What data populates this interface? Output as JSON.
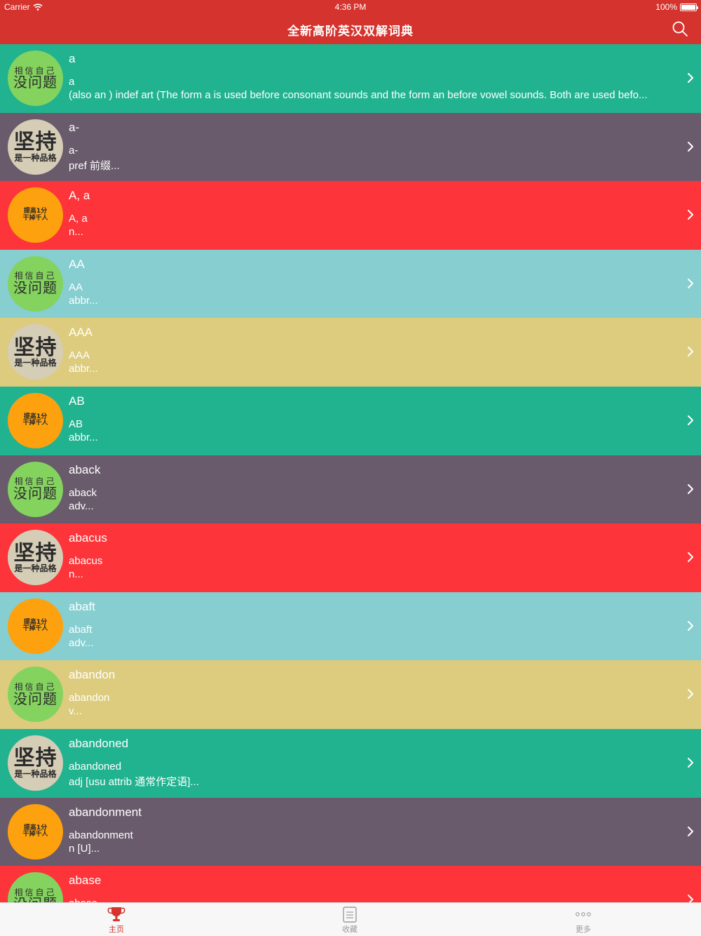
{
  "status_bar": {
    "carrier": "Carrier",
    "time": "4:36 PM",
    "battery": "100%"
  },
  "nav": {
    "title": "全新高阶英汉双解词典",
    "search_icon": "search-icon"
  },
  "colors": {
    "nav": "#d5332d",
    "teal": "#21b38f",
    "slate": "#695b6c",
    "red": "#fd3439",
    "aqua": "#86ced0",
    "sand": "#ddcc7e",
    "tab_active": "#d5332d"
  },
  "avatars": {
    "green": {
      "line1": "相信自己",
      "line2": "没问题"
    },
    "beige": {
      "line1": "坚持",
      "line2": "是一种品格"
    },
    "orange": {
      "line1": "提高1分",
      "line2": "干掉千人"
    }
  },
  "entries": [
    {
      "word": "a",
      "sub": "a",
      "def": "(also an ) indef art (The form a is used before consonant sounds and the form an before vowel sounds. Both are used befo...",
      "color": "#21b38f",
      "avatar": "green"
    },
    {
      "word": "a-",
      "sub": "a-",
      "def": "pref 前缀...",
      "color": "#695b6c",
      "avatar": "beige"
    },
    {
      "word": "A, a",
      "sub": "A, a",
      "def": "n...",
      "color": "#fd3439",
      "avatar": "orange"
    },
    {
      "word": "AA",
      "sub": "AA",
      "def": "abbr...",
      "color": "#86ced0",
      "avatar": "green"
    },
    {
      "word": "AAA",
      "sub": "AAA",
      "def": "abbr...",
      "color": "#ddcc7e",
      "avatar": "beige"
    },
    {
      "word": "AB",
      "sub": "AB",
      "def": "abbr...",
      "color": "#21b38f",
      "avatar": "orange"
    },
    {
      "word": "aback",
      "sub": "aback",
      "def": "adv...",
      "color": "#695b6c",
      "avatar": "green"
    },
    {
      "word": "abacus",
      "sub": "abacus",
      "def": "n...",
      "color": "#fd3439",
      "avatar": "beige"
    },
    {
      "word": "abaft",
      "sub": "abaft",
      "def": "adv...",
      "color": "#86ced0",
      "avatar": "orange"
    },
    {
      "word": "abandon",
      "sub": "abandon",
      "def": "v...",
      "color": "#ddcc7e",
      "avatar": "green"
    },
    {
      "word": "abandoned",
      "sub": "abandoned",
      "def": "adj [usu attrib 通常作定语]...",
      "color": "#21b38f",
      "avatar": "beige"
    },
    {
      "word": "abandonment",
      "sub": "abandonment",
      "def": "n [U]...",
      "color": "#695b6c",
      "avatar": "orange"
    },
    {
      "word": "abase",
      "sub": "abase",
      "def": "",
      "color": "#fd3439",
      "avatar": "green"
    }
  ],
  "tabs": [
    {
      "label": "主页",
      "icon": "trophy-icon",
      "active": true
    },
    {
      "label": "收藏",
      "icon": "document-icon",
      "active": false
    },
    {
      "label": "更多",
      "icon": "more-dots-icon",
      "active": false
    }
  ]
}
